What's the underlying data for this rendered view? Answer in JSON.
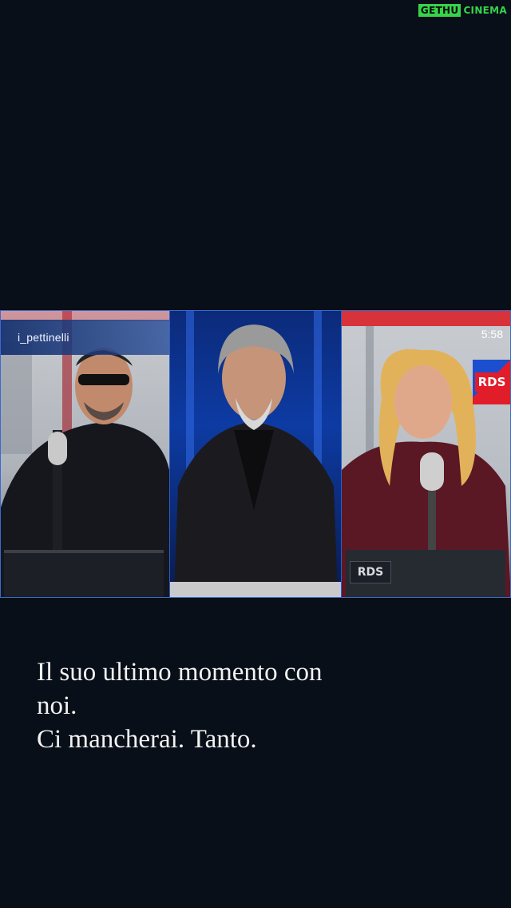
{
  "watermark": {
    "part1": "GETHU",
    "part2": "CINEMA"
  },
  "video": {
    "username": "i_pettinelli",
    "timestamp": "5:58",
    "rds_logo": "RDS",
    "rds_desk": "RDS"
  },
  "caption": {
    "line1": "Il suo ultimo momento con",
    "line2": "noi.",
    "line3": "Ci mancherai. Tanto."
  },
  "colors": {
    "background": "#080f18",
    "accent_blue": "#2c5fc9",
    "watermark_green": "#37d34a",
    "rds_red": "#e11d2a"
  }
}
